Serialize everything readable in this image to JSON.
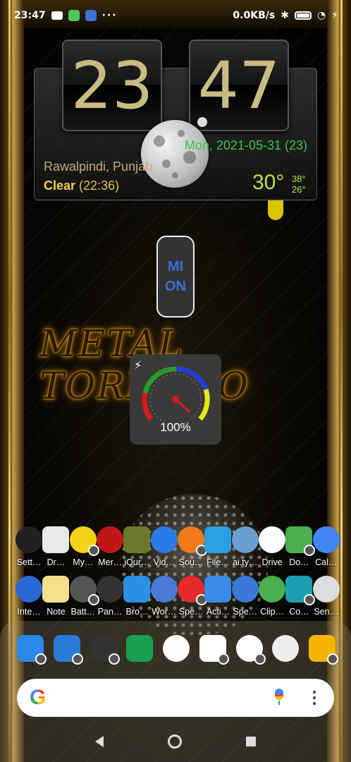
{
  "status_bar": {
    "time": "23:47",
    "network_speed": "0.0KB/s",
    "more": "···"
  },
  "clock_widget": {
    "hours": "23",
    "minutes": "47",
    "date": "Mon, 2021-05-31 (23)",
    "city": "Rawalpindi, Punjab",
    "condition": "Clear",
    "updated": "(22:36)",
    "temperature": "30°",
    "high": "38°",
    "low": "26°"
  },
  "mi_widget": {
    "line1": "MI",
    "line2": "ON"
  },
  "wallpaper_text": "METAL TORNADO",
  "battery_gauge": {
    "value": "100%",
    "level": 1.0
  },
  "apps_row1": [
    {
      "label": "Sett…",
      "icon": "settings-icon",
      "color": "#222222"
    },
    {
      "label": "Dr…",
      "icon": "driver-icon",
      "color": "#e8e8e8"
    },
    {
      "label": "My…",
      "icon": "my-icon",
      "color": "#f4d21a"
    },
    {
      "label": "Mer…",
      "icon": "dictionary-icon",
      "color": "#c01818"
    },
    {
      "label": "iQur…",
      "icon": "quran-icon",
      "color": "#6a7a2a"
    },
    {
      "label": "Vid…",
      "icon": "video-play-icon",
      "color": "#2a7be8"
    },
    {
      "label": "Sou…",
      "icon": "soundhound-icon",
      "color": "#f07a1a"
    },
    {
      "label": "File…",
      "icon": "files-icon",
      "color": "#2aa0e0"
    },
    {
      "label": "ai.ty…",
      "icon": "keyboard-icon",
      "color": "#6aa0d0"
    },
    {
      "label": "Drive",
      "icon": "drive-icon",
      "color": "#ffffff"
    },
    {
      "label": "Do…",
      "icon": "download-icon",
      "color": "#4caf50"
    },
    {
      "label": "Cal…",
      "icon": "calendar-icon",
      "color": "#4285f4"
    }
  ],
  "apps_row2": [
    {
      "label": "Inte…",
      "icon": "internet-speed-icon",
      "color": "#2a6ad8"
    },
    {
      "label": "Note",
      "icon": "note-icon",
      "color": "#f4e08a"
    },
    {
      "label": "Batt…",
      "icon": "battery-app-icon",
      "color": "#555555"
    },
    {
      "label": "Pan…",
      "icon": "calculator-icon",
      "color": "#333333"
    },
    {
      "label": "Bro…",
      "icon": "browser-icon",
      "color": "#2a90e8"
    },
    {
      "label": "Wor…",
      "icon": "world-clock-icon",
      "color": "#4a7ad8"
    },
    {
      "label": "Spe…",
      "icon": "speed-clock-icon",
      "color": "#e82a2a"
    },
    {
      "label": "Acti…",
      "icon": "home-launcher-icon",
      "color": "#3a8ae8"
    },
    {
      "label": "Spe…",
      "icon": "speed-calc-icon",
      "color": "#3a7ad8"
    },
    {
      "label": "Clip…",
      "icon": "clipboard-share-icon",
      "color": "#4caf50"
    },
    {
      "label": "Co…",
      "icon": "compass-icon",
      "color": "#1aa0b0"
    },
    {
      "label": "Sen…",
      "icon": "sensor-icon",
      "color": "#dddddd"
    }
  ],
  "dock": [
    {
      "icon": "contacts-icon",
      "color": "#2a8ae8"
    },
    {
      "icon": "messages-icon",
      "color": "#2a7ad8"
    },
    {
      "icon": "cycling-icon",
      "color": "#333333"
    },
    {
      "icon": "gallery-icon",
      "color": "#1aa050"
    },
    {
      "icon": "app-drawer-icon",
      "color": "#ffffff"
    },
    {
      "icon": "play-store-icon",
      "color": "#ffffff"
    },
    {
      "icon": "chrome-icon",
      "color": "#ffffff"
    },
    {
      "icon": "camera-icon",
      "color": "#eeeeee"
    },
    {
      "icon": "file-manager-icon",
      "color": "#f4b400"
    }
  ],
  "search": {
    "logo": "G"
  }
}
